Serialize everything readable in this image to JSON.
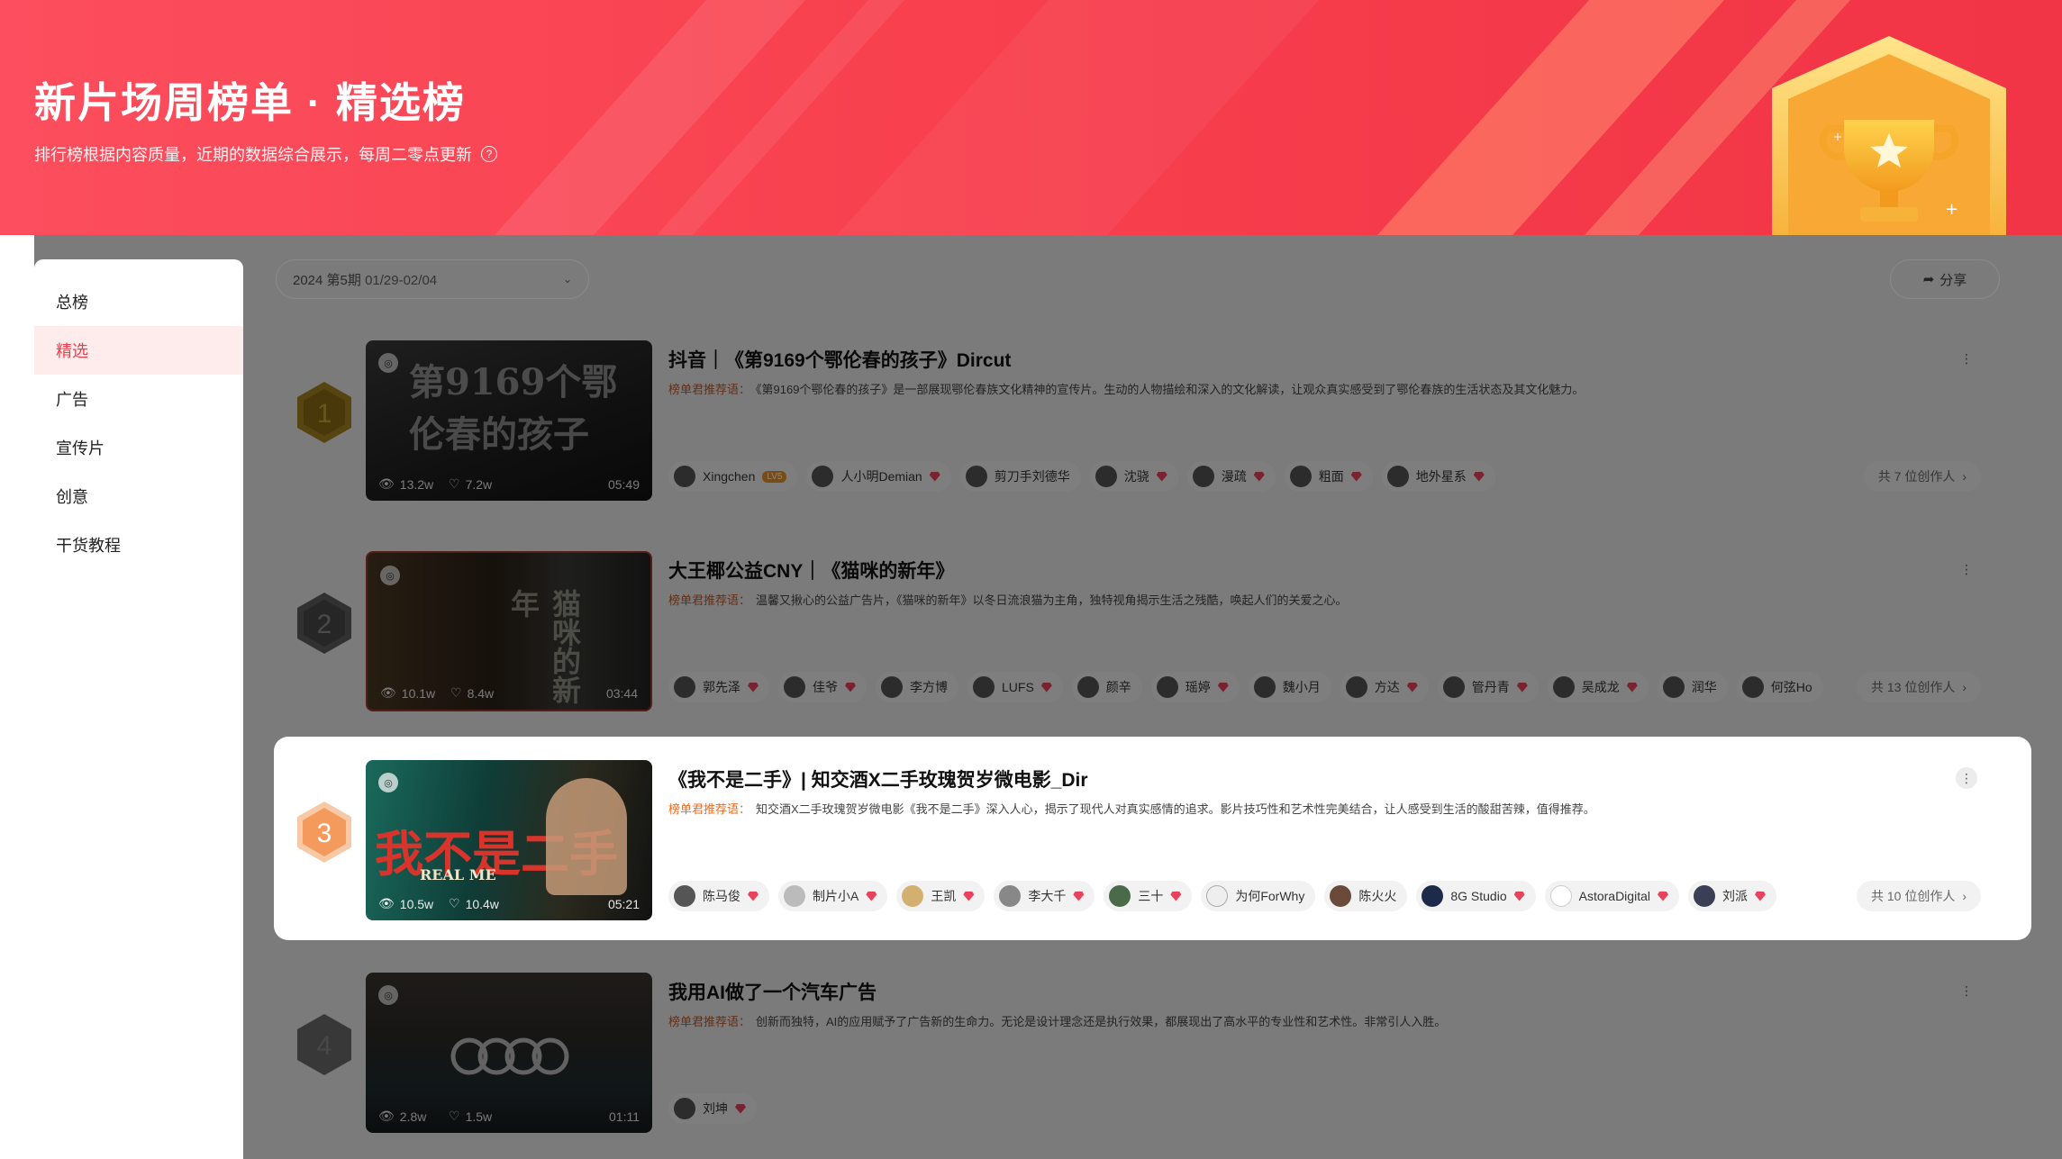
{
  "banner": {
    "title": "新片场周榜单 · 精选榜",
    "subtitle": "排行榜根据内容质量，近期的数据综合展示，每周二零点更新",
    "help_icon": "question-circle-icon"
  },
  "sidebar": {
    "items": [
      {
        "label": "总榜",
        "active": false
      },
      {
        "label": "精选",
        "active": true
      },
      {
        "label": "广告",
        "active": false
      },
      {
        "label": "宣传片",
        "active": false
      },
      {
        "label": "创意",
        "active": false
      },
      {
        "label": "干货教程",
        "active": false
      }
    ]
  },
  "toolbar": {
    "period": "2024 第5期",
    "period_range": "01/29-02/04",
    "share_label": "分享"
  },
  "colors": {
    "accent": "#ef3d4a",
    "banner": "#f8404e",
    "recommend_label": "#c05a2a"
  },
  "rows": [
    {
      "rank": "1",
      "title": "抖音｜《第9169个鄂伦春的孩子》Dircut",
      "recommend_label": "榜单君推荐语：",
      "recommend": "《第9169个鄂伦春的孩子》是一部展现鄂伦春族文化精神的宣传片。生动的人物描绘和深入的文化解读，让观众真实感受到了鄂伦春族的生活状态及其文化魅力。",
      "views": "13.2w",
      "likes": "7.2w",
      "duration": "05:49",
      "thumb_text": "第9169个鄂伦春的孩子",
      "creators": [
        "Xingchen",
        "人小明Demian",
        "剪刀手刘德华",
        "沈骁",
        "漫疏",
        "粗面",
        "地外星系"
      ],
      "creator_level": "LV5",
      "total": "共 7 位创作人"
    },
    {
      "rank": "2",
      "title": "大王椰公益CNY｜《猫咪的新年》",
      "recommend_label": "榜单君推荐语：",
      "recommend": "温馨又揪心的公益广告片，《猫咪的新年》以冬日流浪猫为主角，独特视角揭示生活之残酷，唤起人们的关爱之心。",
      "views": "10.1w",
      "likes": "8.4w",
      "duration": "03:44",
      "thumb_text": "猫咪的新年",
      "creators": [
        "郭先泽",
        "佳爷",
        "李方博",
        "LUFS",
        "颜辛",
        "瑶婷",
        "魏小月",
        "方达",
        "管丹青",
        "吴成龙",
        "润华",
        "何弦Ho"
      ],
      "total": "共 13 位创作人"
    },
    {
      "rank": "3",
      "title": "《我不是二手》| 知交酒X二手玫瑰贺岁微电影_Dir",
      "recommend_label": "榜单君推荐语：",
      "recommend": "知交酒X二手玫瑰贺岁微电影《我不是二手》深入人心，揭示了现代人对真实感情的追求。影片技巧性和艺术性完美结合，让人感受到生活的酸甜苦辣，值得推荐。",
      "views": "10.5w",
      "likes": "10.4w",
      "duration": "05:21",
      "thumb_text": "我不是二手",
      "thumb_sub": "REAL ME",
      "creators": [
        "陈马俊",
        "制片小A",
        "王凯",
        "李大千",
        "三十",
        "为何ForWhy",
        "陈火火",
        "8G Studio",
        "AstoraDigital",
        "刘派"
      ],
      "total": "共 10 位创作人"
    },
    {
      "rank": "4",
      "title": "我用AI做了一个汽车广告",
      "recommend_label": "榜单君推荐语：",
      "recommend": "创新而独特，AI的应用赋予了广告新的生命力。无论是设计理念还是执行效果，都展现出了高水平的专业性和艺术性。非常引人入胜。",
      "views": "2.8w",
      "likes": "1.5w",
      "duration": "01:11",
      "creators": [
        "刘坤"
      ],
      "total": ""
    }
  ]
}
